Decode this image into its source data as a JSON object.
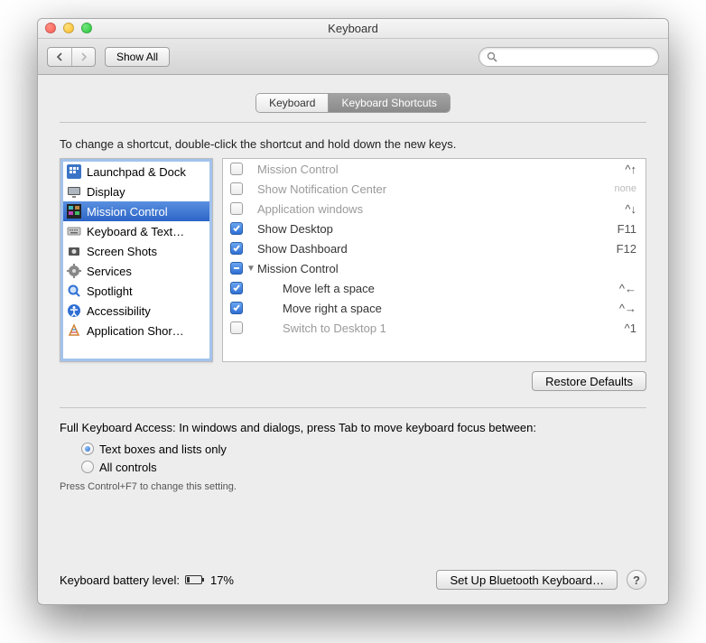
{
  "window": {
    "title": "Keyboard"
  },
  "toolbar": {
    "show_all": "Show All"
  },
  "tabs": {
    "keyboard": "Keyboard",
    "shortcuts": "Keyboard Shortcuts"
  },
  "instructions": "To change a shortcut, double-click the shortcut and hold down the new keys.",
  "categories": [
    {
      "label": "Launchpad & Dock",
      "icon": "launchpad"
    },
    {
      "label": "Display",
      "icon": "display"
    },
    {
      "label": "Mission Control",
      "icon": "mission",
      "selected": true
    },
    {
      "label": "Keyboard & Text…",
      "icon": "keyboard"
    },
    {
      "label": "Screen Shots",
      "icon": "screenshot"
    },
    {
      "label": "Services",
      "icon": "services"
    },
    {
      "label": "Spotlight",
      "icon": "spotlight"
    },
    {
      "label": "Accessibility",
      "icon": "accessibility"
    },
    {
      "label": "Application Shor…",
      "icon": "appshort"
    }
  ],
  "shortcuts": [
    {
      "checked": false,
      "dim": true,
      "label": "Mission Control",
      "key": "^↑"
    },
    {
      "checked": false,
      "dim": true,
      "label": "Show Notification Center",
      "key": "none",
      "keydim": true
    },
    {
      "checked": false,
      "dim": true,
      "label": "Application windows",
      "key": "^↓"
    },
    {
      "checked": true,
      "label": "Show Desktop",
      "key": "F11"
    },
    {
      "checked": true,
      "label": "Show Dashboard",
      "key": "F12"
    },
    {
      "mixed": true,
      "group": true,
      "disclosure": "▼",
      "label": "Mission Control",
      "key": ""
    },
    {
      "checked": true,
      "child": true,
      "label": "Move left a space",
      "key": "^←"
    },
    {
      "checked": true,
      "child": true,
      "label": "Move right a space",
      "key": "^→"
    },
    {
      "checked": false,
      "child": true,
      "dim": true,
      "label": "Switch to Desktop 1",
      "key": "^1"
    }
  ],
  "restore": "Restore Defaults",
  "fka": {
    "text": "Full Keyboard Access: In windows and dialogs, press Tab to move keyboard focus between:",
    "opt1": "Text boxes and lists only",
    "opt2": "All controls",
    "hint": "Press Control+F7 to change this setting."
  },
  "footer": {
    "battery_label": "Keyboard battery level:",
    "battery_pct": "17%",
    "bt_button": "Set Up Bluetooth Keyboard…"
  }
}
